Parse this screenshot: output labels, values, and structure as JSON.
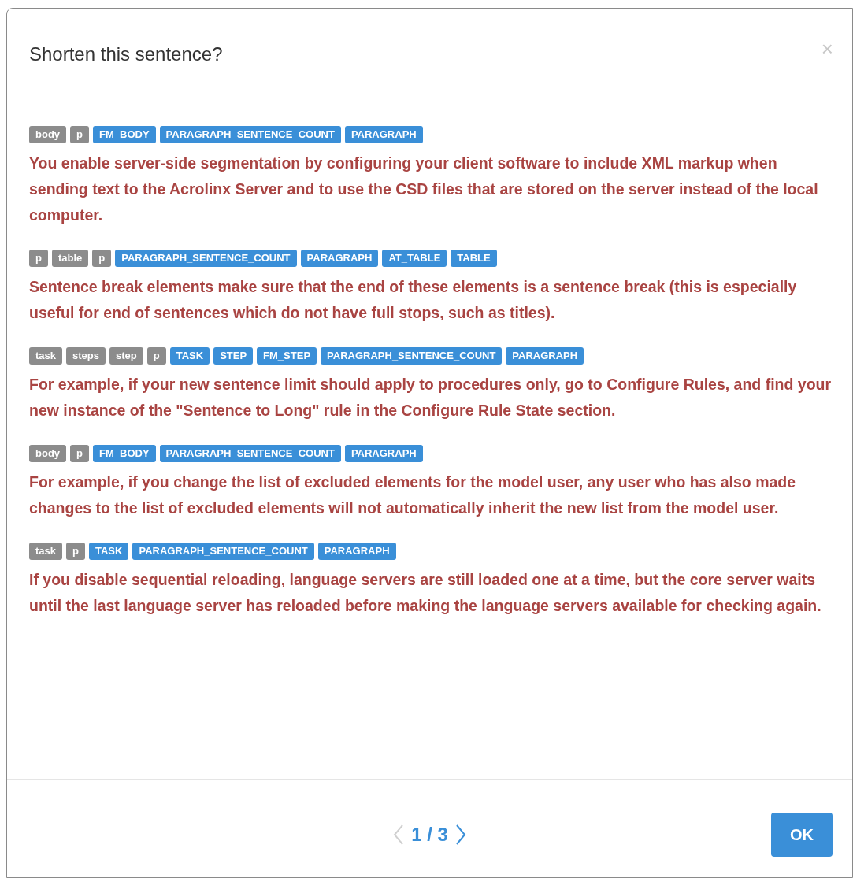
{
  "dialog": {
    "title": "Shorten this sentence?",
    "close": "×"
  },
  "entries": [
    {
      "tags": [
        {
          "label": "body",
          "kind": "element"
        },
        {
          "label": "p",
          "kind": "element"
        },
        {
          "label": "FM_BODY",
          "kind": "class"
        },
        {
          "label": "PARAGRAPH_SENTENCE_COUNT",
          "kind": "class"
        },
        {
          "label": "PARAGRAPH",
          "kind": "class"
        }
      ],
      "text": "You enable server-side segmentation by configuring your client software to include XML markup when sending text to the Acrolinx Server and to use the CSD files that are stored on the server instead of the local computer."
    },
    {
      "tags": [
        {
          "label": "p",
          "kind": "element"
        },
        {
          "label": "table",
          "kind": "element"
        },
        {
          "label": "p",
          "kind": "element"
        },
        {
          "label": "PARAGRAPH_SENTENCE_COUNT",
          "kind": "class"
        },
        {
          "label": "PARAGRAPH",
          "kind": "class"
        },
        {
          "label": "AT_TABLE",
          "kind": "class"
        },
        {
          "label": "TABLE",
          "kind": "class"
        }
      ],
      "text": "Sentence break elements make sure that the end of these elements is a sentence break (this is especially useful for end of sentences which do not have full stops, such as titles)."
    },
    {
      "tags": [
        {
          "label": "task",
          "kind": "element"
        },
        {
          "label": "steps",
          "kind": "element"
        },
        {
          "label": "step",
          "kind": "element"
        },
        {
          "label": "p",
          "kind": "element"
        },
        {
          "label": "TASK",
          "kind": "class"
        },
        {
          "label": "STEP",
          "kind": "class"
        },
        {
          "label": "FM_STEP",
          "kind": "class"
        },
        {
          "label": "PARAGRAPH_SENTENCE_COUNT",
          "kind": "class"
        },
        {
          "label": "PARAGRAPH",
          "kind": "class"
        }
      ],
      "text": "For example, if your new sentence limit should apply to procedures only, go to Configure Rules, and find your new instance of the \"Sentence to Long\" rule in the Configure Rule State section."
    },
    {
      "tags": [
        {
          "label": "body",
          "kind": "element"
        },
        {
          "label": "p",
          "kind": "element"
        },
        {
          "label": "FM_BODY",
          "kind": "class"
        },
        {
          "label": "PARAGRAPH_SENTENCE_COUNT",
          "kind": "class"
        },
        {
          "label": "PARAGRAPH",
          "kind": "class"
        }
      ],
      "text": "For example, if you change the list of excluded elements for the model user, any user who has also made changes to the list of excluded elements will not automatically inherit the new list from the model user."
    },
    {
      "tags": [
        {
          "label": "task",
          "kind": "element"
        },
        {
          "label": "p",
          "kind": "element"
        },
        {
          "label": "TASK",
          "kind": "class"
        },
        {
          "label": "PARAGRAPH_SENTENCE_COUNT",
          "kind": "class"
        },
        {
          "label": "PARAGRAPH",
          "kind": "class"
        }
      ],
      "text": "If you disable sequential reloading, language servers are still loaded one at a time, but the core server waits until the last language server has reloaded before making the language servers available for checking again."
    }
  ],
  "pager": {
    "prev": {
      "disabled": true
    },
    "label": "1 / 3",
    "next": {
      "disabled": false
    }
  },
  "ok_button": "OK"
}
